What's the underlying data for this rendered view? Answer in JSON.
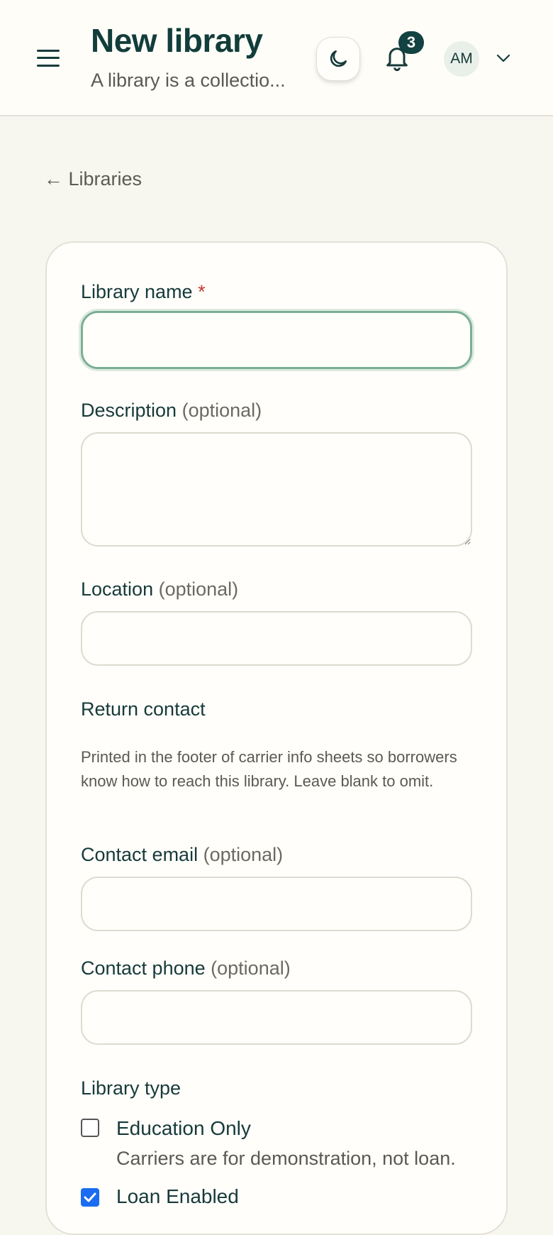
{
  "header": {
    "title": "New library",
    "subtitle": "A library is a collectio...",
    "notification_count": "3",
    "avatar_initials": "AM"
  },
  "nav": {
    "back_label": "← Libraries"
  },
  "form": {
    "name": {
      "label": "Library name",
      "required_mark": "*",
      "value": ""
    },
    "description": {
      "label": "Description",
      "optional": "(optional)",
      "value": ""
    },
    "location": {
      "label": "Location",
      "optional": "(optional)",
      "value": ""
    },
    "return_contact": {
      "heading": "Return contact",
      "help": "Printed in the footer of carrier info sheets so borrowers know how to reach this library. Leave blank to omit."
    },
    "contact_email": {
      "label": "Contact email",
      "optional": "(optional)",
      "value": ""
    },
    "contact_phone": {
      "label": "Contact phone",
      "optional": "(optional)",
      "value": ""
    },
    "library_type": {
      "heading": "Library type",
      "options": [
        {
          "label": "Education Only",
          "description": "Carriers are for demonstration, not loan.",
          "checked": false
        },
        {
          "label": "Loan Enabled",
          "checked": true
        }
      ]
    }
  },
  "icons": {
    "menu": "hamburger-icon",
    "theme": "moon-icon",
    "notifications": "bell-icon",
    "account_menu": "chevron-down-icon"
  },
  "colors": {
    "brand": "#123d3b",
    "focus_ring": "#7bae95",
    "required": "#c23a32",
    "checkbox_checked": "#1a6cf0"
  }
}
